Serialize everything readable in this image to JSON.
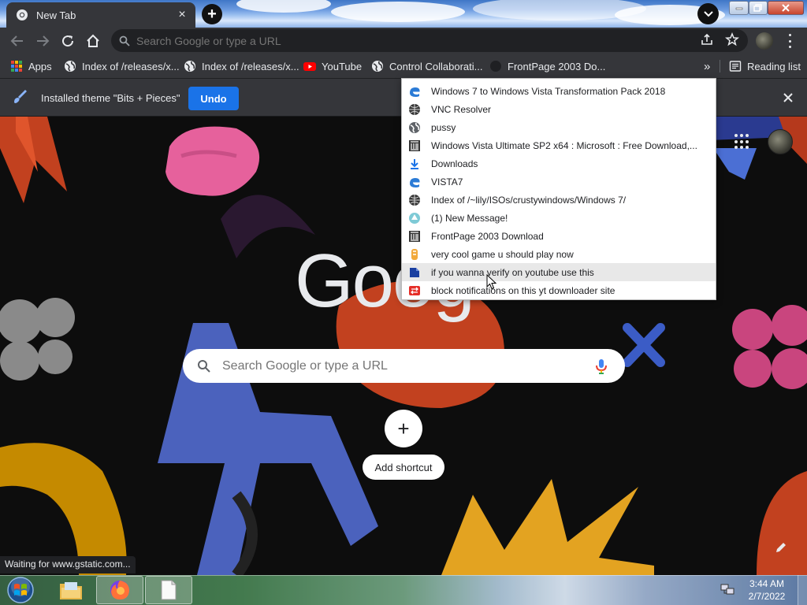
{
  "window": {
    "tab_title": "New Tab",
    "tab_close": "×",
    "new_tab": "+"
  },
  "toolbar": {
    "omnibox_placeholder": "Search Google or type a URL"
  },
  "bookmarks_bar": {
    "items": [
      {
        "label": "Apps",
        "icon": "apps-grid-icon"
      },
      {
        "label": "Index of /releases/x...",
        "icon": "globe-icon"
      },
      {
        "label": "Index of /releases/x...",
        "icon": "globe-icon"
      },
      {
        "label": "YouTube",
        "icon": "youtube-icon"
      },
      {
        "label": "Control Collaborati...",
        "icon": "globe-icon"
      },
      {
        "label": "FrontPage 2003 Do...",
        "icon": "archive-icon"
      }
    ],
    "overflow": "»",
    "reading_list": "Reading list"
  },
  "infobar": {
    "message": "Installed theme \"Bits + Pieces\"",
    "undo_label": "Undo"
  },
  "overflow_menu": {
    "items": [
      {
        "label": "Windows 7 to Windows Vista Transformation Pack 2018",
        "icon": "edge-icon"
      },
      {
        "label": "VNC Resolver",
        "icon": "web-icon"
      },
      {
        "label": "pussy",
        "icon": "globe-icon"
      },
      {
        "label": "Windows Vista Ultimate SP2 x64 : Microsoft : Free Download,...",
        "icon": "archive-org-icon"
      },
      {
        "label": "Downloads",
        "icon": "download-icon"
      },
      {
        "label": "VISTA7",
        "icon": "edge-icon"
      },
      {
        "label": "Index of /~lily/ISOs/crustywindows/Windows 7/",
        "icon": "web-icon"
      },
      {
        "label": "(1) New Message!",
        "icon": "message-icon"
      },
      {
        "label": "FrontPage 2003 Download",
        "icon": "archive-org-icon"
      },
      {
        "label": "very cool game u should play now",
        "icon": "game-icon"
      },
      {
        "label": "if you wanna verify on youtube use this",
        "icon": "verify-icon"
      },
      {
        "label": "block notifications on this yt downloader site",
        "icon": "downloader-icon"
      }
    ]
  },
  "ntp": {
    "logo_text": "Goog",
    "search_placeholder": "Search Google or type a URL",
    "shortcut_plus": "+",
    "add_shortcut_label": "Add shortcut",
    "status_text": "Waiting for www.gstatic.com..."
  },
  "taskbar": {
    "time": "3:44 AM",
    "date": "2/7/2022"
  },
  "colors": {
    "chrome_dark": "#35363a",
    "accent_blue": "#1a73e8",
    "youtube_red": "#ff0000"
  }
}
